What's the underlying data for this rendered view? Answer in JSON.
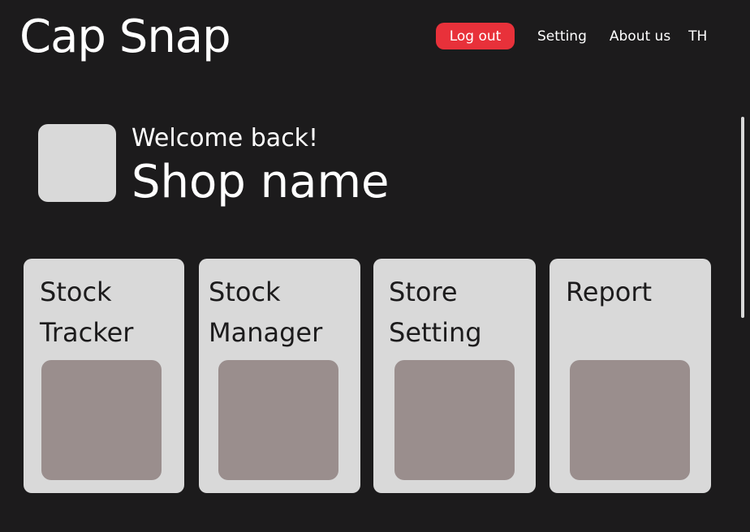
{
  "header": {
    "app_title": "Cap Snap",
    "nav": {
      "logout_label": "Log out",
      "setting_label": "Setting",
      "about_label": "About us",
      "language_label": "TH"
    }
  },
  "welcome": {
    "greeting": "Welcome back!",
    "shop_name": "Shop name"
  },
  "cards": [
    {
      "title": "Stock Tracker"
    },
    {
      "title": "Stock Manager"
    },
    {
      "title": "Store Setting"
    },
    {
      "title": "Report"
    }
  ],
  "colors": {
    "background": "#1c1b1c",
    "logout_button": "#e8313a",
    "card_background": "#d9d9d9",
    "card_thumbnail": "#9a8e8d"
  }
}
